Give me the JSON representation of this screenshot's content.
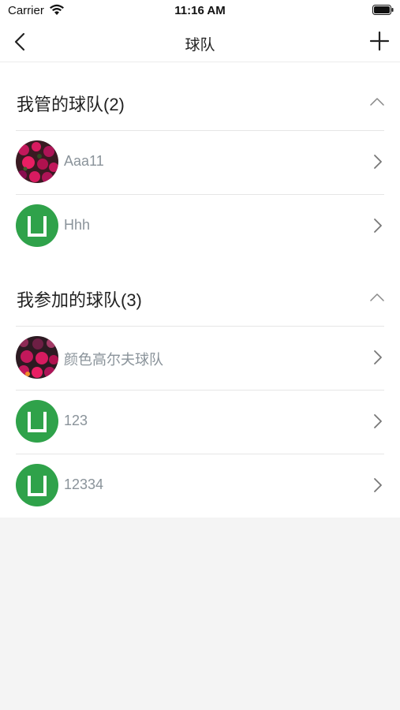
{
  "status_bar": {
    "carrier": "Carrier",
    "time": "11:16 AM"
  },
  "nav": {
    "title": "球队",
    "back_icon": "chevron-left-icon",
    "add_icon": "plus-icon"
  },
  "sections": [
    {
      "title": "我管的球队(2)",
      "expanded": true,
      "items": [
        {
          "name": "Aaa11",
          "avatar": "flower-photo"
        },
        {
          "name": "Hhh",
          "avatar": "default-team-logo"
        }
      ]
    },
    {
      "title": "我参加的球队(3)",
      "expanded": true,
      "items": [
        {
          "name": "颜色高尔夫球队",
          "avatar": "flower-photo"
        },
        {
          "name": "123",
          "avatar": "default-team-logo"
        },
        {
          "name": "12334",
          "avatar": "default-team-logo"
        }
      ]
    }
  ],
  "colors": {
    "accent_green": "#2fa24a",
    "label_gray": "#8a939a",
    "background": "#f4f4f4"
  }
}
